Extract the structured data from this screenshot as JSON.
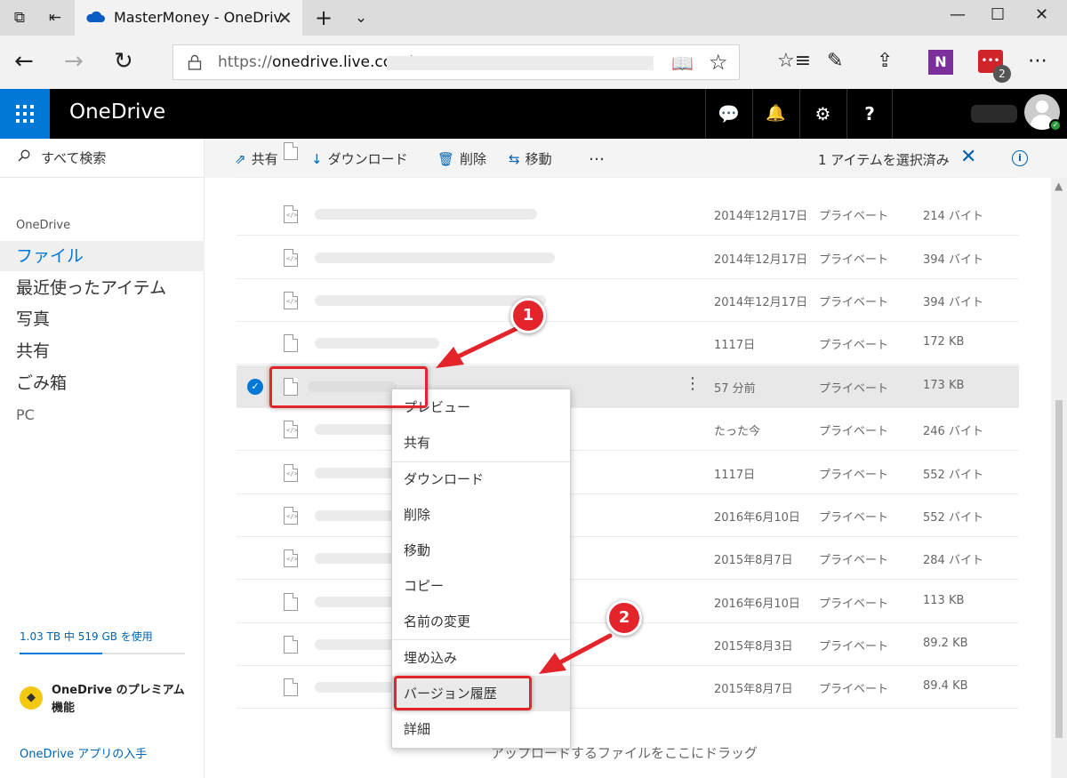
{
  "browser": {
    "tab_title": "MasterMoney - OneDrive",
    "url_prefix": "https://",
    "url_host": "onedrive.live.com/",
    "extension_badge": "2",
    "onenote_label": "N"
  },
  "header": {
    "brand": "OneDrive",
    "help_label": "?"
  },
  "leftnav": {
    "search_placeholder": "すべて検索",
    "section": "OneDrive",
    "items": [
      {
        "label": "ファイル"
      },
      {
        "label": "最近使ったアイテム"
      },
      {
        "label": "写真"
      },
      {
        "label": "共有"
      },
      {
        "label": "ごみ箱"
      },
      {
        "label": "PC"
      }
    ],
    "quota_text": "1.03 TB 中 519 GB を使用",
    "quota_used_fraction": 0.5,
    "premium_text": "OneDrive のプレミアム機能",
    "get_app": "OneDrive アプリの入手"
  },
  "commands": {
    "share": "共有",
    "download": "ダウンロード",
    "delete": "削除",
    "move": "移動",
    "more": "…",
    "selection": "1 アイテムを選択済み"
  },
  "files": [
    {
      "date": "2014年12月17日",
      "sharing": "プライベート",
      "size": "214 バイト"
    },
    {
      "date": "2014年12月17日",
      "sharing": "プライベート",
      "size": "394 バイト"
    },
    {
      "date": "2014年12月17日",
      "sharing": "プライベート",
      "size": "394 バイト"
    },
    {
      "date": "1117日",
      "sharing": "プライベート",
      "size": "172 KB"
    },
    {
      "date": "57 分前",
      "sharing": "プライベート",
      "size": "173 KB"
    },
    {
      "date": "たった今",
      "sharing": "プライベート",
      "size": "246 バイト"
    },
    {
      "date": "1117日",
      "sharing": "プライベート",
      "size": "552 バイト"
    },
    {
      "date": "2016年6月10日",
      "sharing": "プライベート",
      "size": "552 バイト"
    },
    {
      "date": "2015年8月7日",
      "sharing": "プライベート",
      "size": "284 バイト"
    },
    {
      "date": "2016年6月10日",
      "sharing": "プライベート",
      "size": "113 KB"
    },
    {
      "date": "2015年8月3日",
      "sharing": "プライベート",
      "size": "89.2 KB"
    },
    {
      "date": "2015年8月7日",
      "sharing": "プライベート",
      "size": "89.4 KB"
    }
  ],
  "drop_hint": "アップロードするファイルをここにドラッグ",
  "context_menu": [
    {
      "label": "プレビュー"
    },
    {
      "label": "共有"
    },
    {
      "label": "ダウンロード"
    },
    {
      "label": "削除"
    },
    {
      "label": "移動"
    },
    {
      "label": "コピー"
    },
    {
      "label": "名前の変更"
    },
    {
      "label": "埋め込み"
    },
    {
      "label": "バージョン履歴"
    },
    {
      "label": "詳細"
    }
  ],
  "annotations": {
    "step1": "1",
    "step2": "2",
    "color": "#e3242b"
  }
}
